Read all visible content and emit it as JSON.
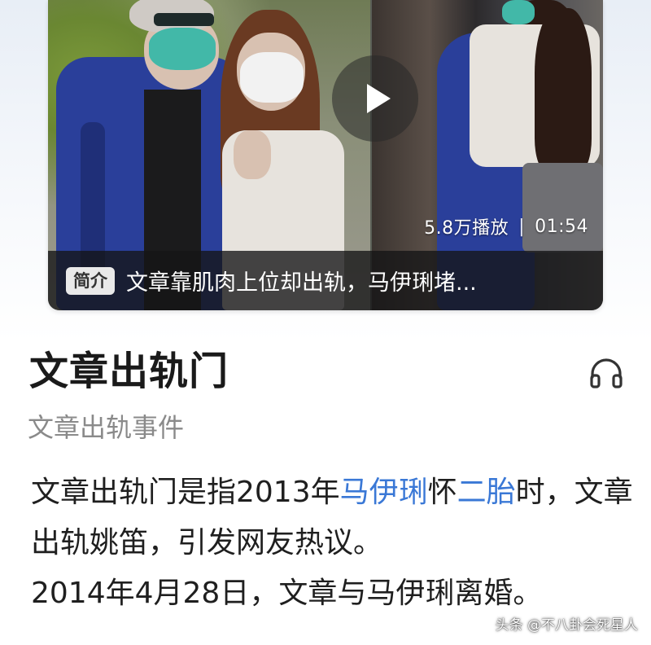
{
  "video": {
    "play_count": "5.8万播放",
    "separator": "|",
    "duration": "01:54",
    "intro_badge": "简介",
    "intro_text": "文章靠肌肉上位却出轨，马伊琍堵..."
  },
  "entry": {
    "title": "文章出轨门",
    "subtitle": "文章出轨事件",
    "body": {
      "part1": "文章出轨门是指2013年",
      "link1": "马伊琍",
      "part2": "怀",
      "link2": "二胎",
      "part3": "时，文章出轨姚笛，引发网友热议。",
      "part4": "2014年4月28日，文章与马伊琍离婚。"
    }
  },
  "watermark": "头条 @不八卦会死星人",
  "colors": {
    "link": "#3a78d6",
    "subtitle": "#8a8a8a",
    "title": "#1a1a1a"
  },
  "icons": {
    "play": "play-icon",
    "headphones": "headphones-icon"
  }
}
